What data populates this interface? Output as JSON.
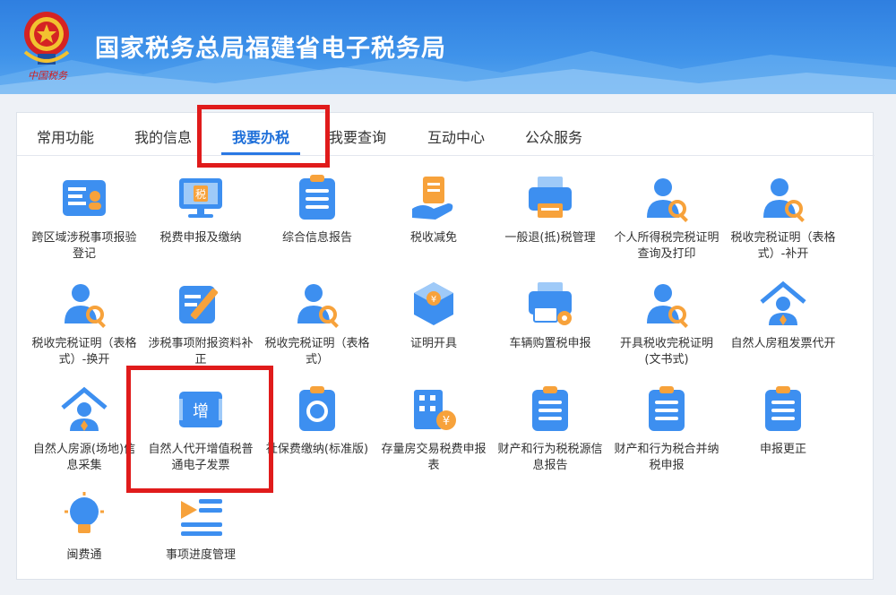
{
  "header": {
    "title": "国家税务总局福建省电子税务局",
    "emblem_caption": "中国税务"
  },
  "tabs": [
    {
      "label": "常用功能"
    },
    {
      "label": "我的信息"
    },
    {
      "label": "我要办税"
    },
    {
      "label": "我要查询"
    },
    {
      "label": "互动中心"
    },
    {
      "label": "公众服务"
    }
  ],
  "active_tab": "我要办税",
  "grid": [
    {
      "label": "跨区域涉税事项报验登记",
      "icon": "id-card-icon"
    },
    {
      "label": "税费申报及缴纳",
      "icon": "tax-monitor-icon"
    },
    {
      "label": "综合信息报告",
      "icon": "clipboard-list-icon"
    },
    {
      "label": "税收减免",
      "icon": "hand-document-icon"
    },
    {
      "label": "一般退(抵)税管理",
      "icon": "printer-icon"
    },
    {
      "label": "个人所得税完税证明查询及打印",
      "icon": "person-search-icon"
    },
    {
      "label": "税收完税证明（表格式）-补开",
      "icon": "person-search-icon"
    },
    {
      "label": "税收完税证明（表格式）-换开",
      "icon": "person-search-icon"
    },
    {
      "label": "涉税事项附报资料补正",
      "icon": "edit-pencil-icon"
    },
    {
      "label": "税收完税证明（表格式）",
      "icon": "person-search-icon"
    },
    {
      "label": "证明开具",
      "icon": "yuan-box-icon"
    },
    {
      "label": "车辆购置税申报",
      "icon": "printer-gear-icon"
    },
    {
      "label": "开具税收完税证明(文书式)",
      "icon": "person-search-icon"
    },
    {
      "label": "自然人房租发票代开",
      "icon": "house-person-icon"
    },
    {
      "label": "自然人房源(场地)信息采集",
      "icon": "house-person-icon"
    },
    {
      "label": "自然人代开增值税普通电子发票",
      "icon": "vat-invoice-icon"
    },
    {
      "label": "社保费缴纳(标准版)",
      "icon": "clipboard-coin-icon"
    },
    {
      "label": "存量房交易税费申报表",
      "icon": "building-yuan-icon"
    },
    {
      "label": "财产和行为税税源信息报告",
      "icon": "clipboard-list-icon"
    },
    {
      "label": "财产和行为税合并纳税申报",
      "icon": "clipboard-list-icon"
    },
    {
      "label": "申报更正",
      "icon": "clipboard-list-icon"
    },
    {
      "label": "闽费通",
      "icon": "lightbulb-icon"
    },
    {
      "label": "事项进度管理",
      "icon": "progress-list-icon"
    }
  ],
  "colors": {
    "header": "#3a8be6",
    "accent": "#1e6fd9",
    "icon_blue": "#3d8ff0",
    "icon_orange": "#f7a23b",
    "highlight": "#e01b1b"
  }
}
